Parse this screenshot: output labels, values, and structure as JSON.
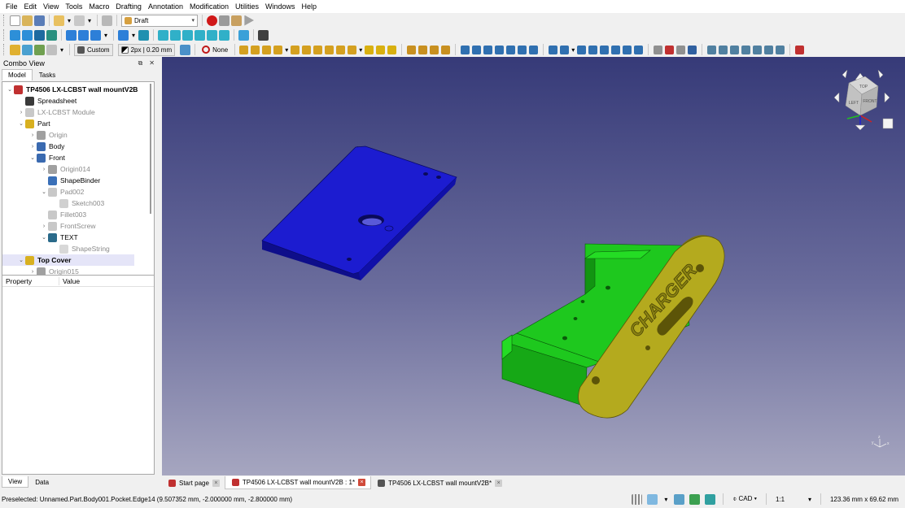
{
  "menu": [
    "File",
    "Edit",
    "View",
    "Tools",
    "Macro",
    "Drafting",
    "Annotation",
    "Modification",
    "Utilities",
    "Windows",
    "Help"
  ],
  "toolbar": {
    "workbench": "Draft",
    "style_mode": "Custom",
    "line_style": "2px | 0.20 mm",
    "snap_none": "None"
  },
  "combo_view": {
    "title": "Combo View",
    "tabs": [
      "Model",
      "Tasks"
    ],
    "bottom_tabs": [
      "View",
      "Data"
    ]
  },
  "tree": [
    {
      "label": "TP4506 LX-LCBST wall mountV2B",
      "indent": 0,
      "twisty": "v",
      "icon": "doc",
      "bold": true
    },
    {
      "label": "Spreadsheet",
      "indent": 1,
      "twisty": "",
      "icon": "sheet"
    },
    {
      "label": "LX-LCBST Module",
      "indent": 1,
      "twisty": ">",
      "icon": "ghost",
      "dim": true
    },
    {
      "label": "Part",
      "indent": 1,
      "twisty": "v",
      "icon": "part"
    },
    {
      "label": "Origin",
      "indent": 2,
      "twisty": ">",
      "icon": "origin",
      "dim": true
    },
    {
      "label": "Body",
      "indent": 2,
      "twisty": ">",
      "icon": "body"
    },
    {
      "label": "Front",
      "indent": 2,
      "twisty": "v",
      "icon": "body"
    },
    {
      "label": "Origin014",
      "indent": 3,
      "twisty": ">",
      "icon": "origin",
      "dim": true
    },
    {
      "label": "ShapeBinder",
      "indent": 3,
      "twisty": "",
      "icon": "binder"
    },
    {
      "label": "Pad002",
      "indent": 3,
      "twisty": "v",
      "icon": "ghost",
      "dim": true
    },
    {
      "label": "Sketch003",
      "indent": 4,
      "twisty": "",
      "icon": "sketch",
      "dim": true
    },
    {
      "label": "Fillet003",
      "indent": 3,
      "twisty": "",
      "icon": "ghost",
      "dim": true
    },
    {
      "label": "FrontScrew",
      "indent": 3,
      "twisty": ">",
      "icon": "ghost",
      "dim": true
    },
    {
      "label": "TEXT",
      "indent": 3,
      "twisty": "v",
      "icon": "text"
    },
    {
      "label": "ShapeString",
      "indent": 4,
      "twisty": "",
      "icon": "shapestring",
      "dim": true
    },
    {
      "label": "Top Cover",
      "indent": 1,
      "twisty": "v",
      "icon": "part",
      "bold": true,
      "selected": true
    },
    {
      "label": "Origin015",
      "indent": 2,
      "twisty": ">",
      "icon": "origin",
      "dim": true
    }
  ],
  "properties": {
    "col_property": "Property",
    "col_value": "Value"
  },
  "scene": {
    "engraved_text": "CHARGER",
    "colors": {
      "plate": "#1c1cd0",
      "plate_side": "#0e0e8a",
      "bracket": "#1ec81e",
      "bracket_dark": "#129412",
      "cover": "#b4aa1e",
      "cover_side": "#7c7410"
    }
  },
  "navcube": {
    "top": "TOP",
    "left": "LEFT",
    "front": "FRONT"
  },
  "doc_tabs": [
    {
      "label": "Start page",
      "icon": "freecad-icon",
      "close": "gray",
      "active": false
    },
    {
      "label": "TP4506 LX-LCBST wall mountV2B : 1*",
      "icon": "freecad-icon",
      "close": "red",
      "active": true
    },
    {
      "label": "TP4506 LX-LCBST wall mountV2B*",
      "icon": "spreadsheet-icon",
      "close": "gray",
      "active": false
    }
  ],
  "status": {
    "message": "Preselected: Unnamed.Part.Body001.Pocket.Edge14 (9.507352 mm, -2.000000 mm, -2.800000 mm)",
    "nav_style": "CAD",
    "scale": "1:1",
    "dimensions": "123.36 mm x 69.62 mm"
  }
}
